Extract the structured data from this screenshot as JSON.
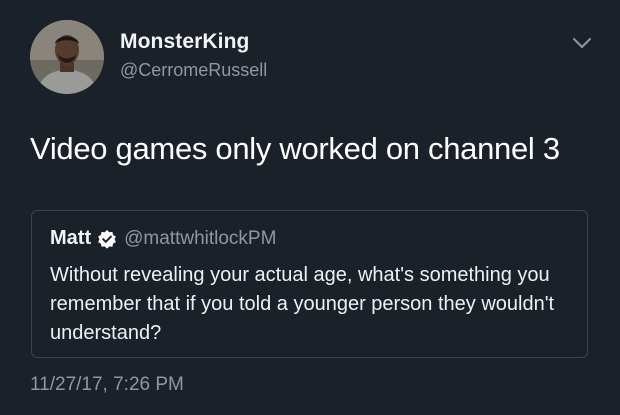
{
  "tweet": {
    "author_name": "MonsterKing",
    "author_handle": "@CerromeRussell",
    "text": "Video games only worked on channel 3",
    "timestamp": "11/27/17, 7:26 PM"
  },
  "quoted_tweet": {
    "author_name": "Matt",
    "author_handle": "@mattwhitlockPM",
    "text": "Without revealing your actual age, what's something you remember that if you told a younger person they wouldn't understand?"
  },
  "icons": {
    "avatar": "user-photo",
    "verified": "verified-badge-icon",
    "menu": "chevron-down-icon"
  },
  "colors": {
    "background": "#1b2129",
    "secondary_text": "#8d98a3",
    "card_border": "#384350"
  }
}
